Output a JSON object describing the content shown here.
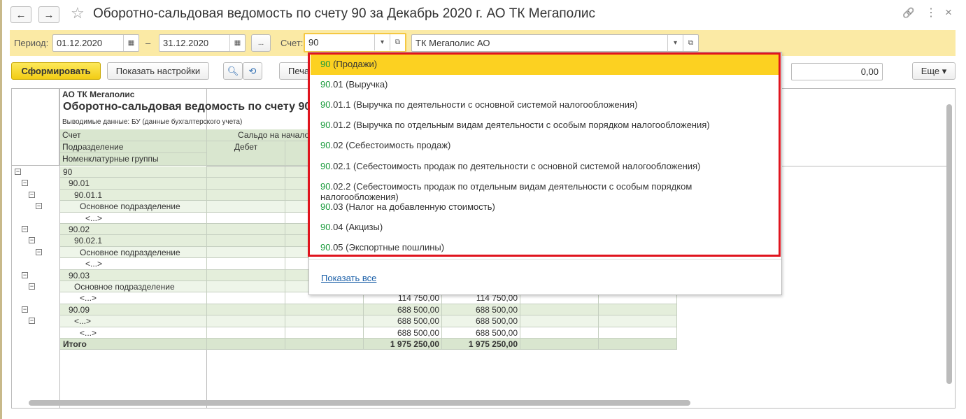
{
  "window": {
    "title": "Оборотно-сальдовая ведомость по счету 90 за Декабрь 2020 г. АО ТК Мегаполис",
    "back_icon": "←",
    "forward_icon": "→",
    "star_icon": "☆",
    "link_icon": "🔗",
    "more_icon": "⋮",
    "close_icon": "×"
  },
  "filters": {
    "period_label": "Период:",
    "date_from": "01.12.2020",
    "dash": "–",
    "date_to": "31.12.2020",
    "period_btn": "...",
    "account_label": "Счет:",
    "account_value": "90",
    "org_value": "ТК Мегаполис АО"
  },
  "toolbar": {
    "generate": "Сформировать",
    "show_settings": "Показать настройки",
    "print": "Печать",
    "sum_value": "0,00",
    "more": "Еще ▾"
  },
  "report": {
    "org": "АО ТК Мегаполис",
    "title": "Оборотно-сальдовая ведомость по счету 90",
    "output": "Выводимые данные:  БУ (данные бухгалтерского учета)",
    "h_account": "Счет",
    "h_division": "Подразделение",
    "h_groups": "Номенклатурные группы",
    "h_saldo_start": "Сальдо на начало п",
    "h_debit": "Дебет",
    "rows": [
      {
        "name": "90",
        "level": 0,
        "type": "g",
        "v1": "",
        "v2": ""
      },
      {
        "name": "90.01",
        "level": 1,
        "type": "g",
        "v1": "",
        "v2": ""
      },
      {
        "name": "90.01.1",
        "level": 2,
        "type": "g",
        "v1": "",
        "v2": ""
      },
      {
        "name": "Основное подразделение",
        "level": 3,
        "type": "d",
        "v1": "",
        "v2": ""
      },
      {
        "name": "<...>",
        "level": 4,
        "type": "w",
        "v1": "",
        "v2": ""
      },
      {
        "name": "90.02",
        "level": 1,
        "type": "g",
        "v1": "",
        "v2": ""
      },
      {
        "name": "90.02.1",
        "level": 2,
        "type": "g",
        "v1": "",
        "v2": ""
      },
      {
        "name": "Основное подразделение",
        "level": 3,
        "type": "d",
        "v1": "",
        "v2": ""
      },
      {
        "name": "<...>",
        "level": 4,
        "type": "w",
        "v1": "",
        "v2": ""
      },
      {
        "name": "90.03",
        "level": 1,
        "type": "g",
        "v1": "",
        "v2": ""
      },
      {
        "name": "Основное подразделение",
        "level": 2,
        "type": "d",
        "v1": "",
        "v2": ""
      },
      {
        "name": "<...>",
        "level": 3,
        "type": "w",
        "v1": "114 750,00",
        "v2": "114 750,00"
      },
      {
        "name": "90.09",
        "level": 1,
        "type": "g",
        "v1": "688 500,00",
        "v2": "688 500,00"
      },
      {
        "name": "<...>",
        "level": 2,
        "type": "d",
        "v1": "688 500,00",
        "v2": "688 500,00"
      },
      {
        "name": "<...>",
        "level": 3,
        "type": "w",
        "v1": "688 500,00",
        "v2": "688 500,00"
      }
    ],
    "total": {
      "name": "Итого",
      "v1": "1 975 250,00",
      "v2": "1 975 250,00"
    }
  },
  "dropdown": {
    "items": [
      {
        "code": "90",
        "rest": " (Продажи)"
      },
      {
        "code": "90",
        "rest": ".01 (Выручка)"
      },
      {
        "code": "90",
        "rest": ".01.1 (Выручка по деятельности с основной системой налогообложения)"
      },
      {
        "code": "90",
        "rest": ".01.2 (Выручка по отдельным видам деятельности с особым порядком налогообложения)"
      },
      {
        "code": "90",
        "rest": ".02 (Себестоимость продаж)"
      },
      {
        "code": "90",
        "rest": ".02.1 (Себестоимость продаж по деятельности с основной системой налогообложения)"
      },
      {
        "code": "90",
        "rest": ".02.2 (Себестоимость продаж по отдельным видам деятельности с особым порядком налогообложения)"
      },
      {
        "code": "90",
        "rest": ".03 (Налог на добавленную стоимость)"
      },
      {
        "code": "90",
        "rest": ".04 (Акцизы)"
      },
      {
        "code": "90",
        "rest": ".05 (Экспортные пошлины)"
      }
    ],
    "show_all": "Показать все"
  },
  "colors": {
    "accent": "#fcd121",
    "highlight_border": "#e0141e",
    "code_green": "#1a9b3c"
  }
}
